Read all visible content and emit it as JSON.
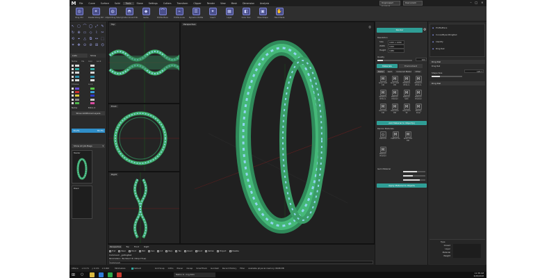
{
  "app": {
    "logo": "M",
    "menu": [
      "File",
      "Curve",
      "Surface",
      "Solid",
      "Tools",
      "Stone",
      "Settings",
      "Cutters",
      "Transform",
      "Clipper",
      "Render",
      "View",
      "Mesh",
      "Dimension",
      "Analysis"
    ],
    "active_menu": "Tools",
    "field_one": "Ungrouped Content",
    "field_two": "Use Lorem"
  },
  "toolbar": [
    {
      "label": "Ring Util",
      "icon": "◎"
    },
    {
      "label": "Create String Ctrl",
      "icon": "✶"
    },
    {
      "label": "Adjust Ring Size",
      "icon": "◍"
    },
    {
      "label": "Cylinder Around Sh.",
      "icon": "◓"
    },
    {
      "label": "Gems",
      "icon": "◆"
    },
    {
      "label": "Profile Place",
      "icon": "⌒"
    },
    {
      "label": "Profile Lines",
      "icon": "⌁"
    },
    {
      "label": "Dynamic Profile",
      "icon": "☰"
    },
    {
      "label": "Insert",
      "icon": "✦"
    },
    {
      "label": "Layer",
      "icon": "▦"
    },
    {
      "label": "Color Tool",
      "icon": "◧"
    },
    {
      "label": "Pave Shape",
      "icon": "▣"
    },
    {
      "label": "Hand Made",
      "icon": "✋"
    }
  ],
  "left_panel": {
    "tab_left": "Lists",
    "tab_right": "Show",
    "headers": [
      "Name",
      "Vis",
      "Icon",
      "Lock"
    ],
    "layers": [
      {
        "name": "",
        "color": "#d9d9d9"
      },
      {
        "name": "",
        "color": "#2ea8a0"
      },
      {
        "name": "",
        "color": "#d9d9d9"
      },
      {
        "name": "",
        "color": "#2e8ea8"
      },
      {
        "name": "",
        "color": "#d9d9d9"
      }
    ],
    "group_headers": [
      "Choose",
      "Lock"
    ],
    "groups": [
      {
        "color_a": "#6a4fd8",
        "color_b": "#58c84a"
      },
      {
        "color_a": "#c82e2e",
        "color_b": "#3aa0d8"
      },
      {
        "color_a": "#d8c83a",
        "color_b": "#2e3ac8"
      },
      {
        "color_a": "#8a8a8a",
        "color_b": "#c8c8c8"
      },
      {
        "color_a": "#4fb84a",
        "color_b": "#d84aa0"
      }
    ],
    "bottom_row": [
      "Name",
      "Extra 4"
    ],
    "show_all_button": "Show Additional Layers",
    "selected_value": "79.2%",
    "selected_value_right": "78.3%",
    "dropdown": "Show All Job Bags",
    "thumbs": [
      {
        "label": "Master"
      },
      {
        "label": "Blank"
      }
    ]
  },
  "viewports": {
    "top": "Top",
    "front": "Front",
    "right": "Right",
    "perspective": "Perspective"
  },
  "command_bar": {
    "tabs": [
      "Perspective",
      "Top",
      "Front",
      "Right"
    ],
    "checkboxes": [
      "End",
      "Near",
      "Point",
      "Mid",
      "Cen",
      "Int",
      "Perp",
      "Tan",
      "Quad",
      "Knot",
      "Vertex",
      "Project",
      "Disable"
    ],
    "command_label": "Command:",
    "command_value": "_gsRingRail",
    "params_label": "Parameters:",
    "params_value": "(Number=3) (Strip=True)",
    "command_prompt": "Command:"
  },
  "status_bar": {
    "plane": "CPlane",
    "x": "x 0.171",
    "y": "y 0.131",
    "z": "z 0.000",
    "units": "Millimeters",
    "layer": "Default",
    "items": [
      "Grid Snap",
      "Ortho",
      "Planar",
      "Osnap",
      "SmartTrack",
      "Gumball",
      "Record History",
      "Filter",
      "Available physical memory: 8698 MB"
    ]
  },
  "render_panel": {
    "render_button": "Render",
    "resolution_label": "Resolution",
    "fields": [
      {
        "name": "Size",
        "value": "1920 x 1080"
      },
      {
        "name": "Width",
        "value": "1920"
      },
      {
        "name": "Height",
        "value": "1080"
      }
    ],
    "quality_label": "Quality",
    "quality_value": "100",
    "tabs": [
      "Materials",
      "Environment"
    ],
    "sub_tabs": [
      "Metal",
      "Gem",
      "Coloured Metal",
      "Other"
    ],
    "materials": [
      {
        "label": "Green Gold 14K",
        "icon": "M"
      },
      {
        "label": "Green Gold 18K",
        "icon": "M"
      },
      {
        "label": "Palladium White G.",
        "icon": "M"
      },
      {
        "label": "Palladium White G.",
        "icon": "M"
      },
      {
        "label": "Palladium White G.",
        "icon": "M"
      },
      {
        "label": "Platinum Polished",
        "icon": "M"
      },
      {
        "label": "Platinum Satin",
        "icon": "M"
      },
      {
        "label": "Platinum Brushed",
        "icon": "M"
      },
      {
        "label": "Rose Gold 14K",
        "icon": "M"
      },
      {
        "label": "Rose Gold 18K",
        "icon": "M"
      },
      {
        "label": "Rose Gold 9K",
        "icon": "M"
      },
      {
        "label": "Sterling Silver",
        "icon": "M"
      }
    ],
    "add_button": "Add Material to Object(s)",
    "render_materials_label": "Render Materials",
    "render_materials": [
      {
        "label": "Diamond",
        "icon": "◇"
      },
      {
        "label": "Platinum Po",
        "icon": "M"
      },
      {
        "label": "Green Gold 18K",
        "icon": "M"
      },
      {
        "label": "Platinum Brushed",
        "icon": "M"
      }
    ],
    "gem_material_label": "Gem Material",
    "apply_button": "Apply Material to Objects"
  },
  "history_panel": {
    "items": [
      {
        "label": "ProfilePlace",
        "icon": "◆"
      },
      {
        "label": "CurvedByandRingRail",
        "icon": "◆"
      },
      {
        "label": "Identify",
        "icon": "◆"
      },
      {
        "label": "Ring Rail",
        "icon": "◆"
      }
    ],
    "section_one": "Ring Rail",
    "param_label": "Ring Rail",
    "param_value": "125.7",
    "param_label_two": "Shape Size",
    "section_two": "Ring Rail",
    "props_title": "Type",
    "props": [
      {
        "name": "Closed",
        "value": ""
      },
      {
        "name": "Layer",
        "value": ""
      },
      {
        "name": "Material",
        "value": ""
      },
      {
        "name": "Weight",
        "value": ""
      }
    ]
  },
  "taskbar": {
    "app_label": "Matrix 9 - ring.3dm",
    "clock": "11:38 AM",
    "date": "6/28/2018"
  }
}
